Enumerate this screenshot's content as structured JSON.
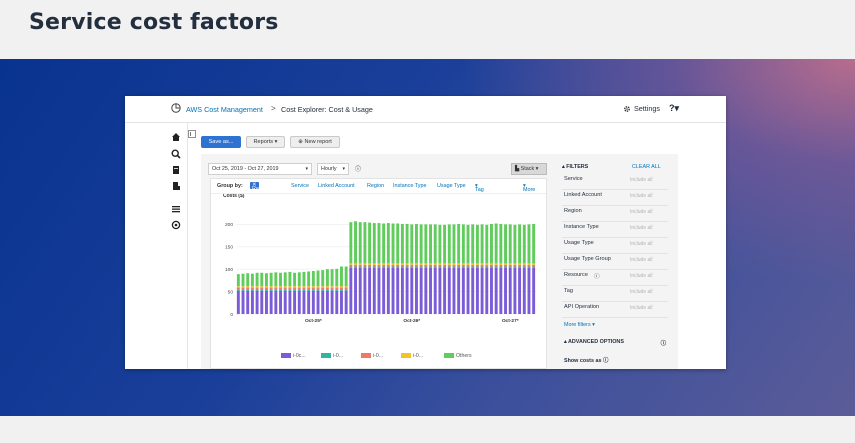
{
  "page": {
    "title": "Service cost factors"
  },
  "console": {
    "breadcrumb": {
      "root": "AWS Cost Management",
      "separator": ">",
      "current": "Cost Explorer: Cost & Usage"
    },
    "settings_label": "Settings",
    "help_label": "?",
    "toolbar": {
      "save": "Save as...",
      "reports": "Reports",
      "new_report": "New report"
    },
    "controls": {
      "date_range": "Oct 25, 2019 - Oct 27, 2019",
      "granularity": "Hourly",
      "chart_style": "Stack"
    },
    "group_by": {
      "label": "Group by:",
      "selected": "Resource",
      "options": [
        "Service",
        "Linked Account",
        "Region",
        "Instance Type",
        "Usage Type",
        "Tag"
      ],
      "more": "More"
    },
    "filters": {
      "title": "FILTERS",
      "clear_all": "CLEAR ALL",
      "rows": [
        {
          "label": "Service",
          "value": "Include all"
        },
        {
          "label": "Linked Account",
          "value": "Include all"
        },
        {
          "label": "Region",
          "value": "Include all"
        },
        {
          "label": "Instance Type",
          "value": "Include all"
        },
        {
          "label": "Usage Type",
          "value": "Include all"
        },
        {
          "label": "Usage Type Group",
          "value": "Include all"
        },
        {
          "label": "Resource",
          "value": "Include all"
        },
        {
          "label": "Tag",
          "value": "Include all"
        },
        {
          "label": "API Operation",
          "value": "Include all"
        }
      ],
      "more_filters": "More filters",
      "advanced_options": "ADVANCED OPTIONS",
      "show_costs_as": "Show costs as"
    }
  },
  "colors": {
    "purple": "#7b5cd6",
    "teal": "#2fb5a0",
    "salmon": "#f07866",
    "yellow": "#f5c323",
    "green": "#5fcc5c",
    "primary": "#2e72d2",
    "link": "#0073bb"
  },
  "chart_data": {
    "type": "bar",
    "stacked": true,
    "ylabel": "Costs ($)",
    "ylim": [
      0,
      250
    ],
    "yticks": [
      0,
      50,
      100,
      150,
      200
    ],
    "x_tick_labels": [
      "Oct-25*",
      "Oct-26*",
      "Oct-27*"
    ],
    "grid": true,
    "legend_position": "bottom",
    "series": [
      {
        "name": "i-0c...",
        "color": "#7b5cd6"
      },
      {
        "name": "i-0...",
        "color": "#2fb5a0"
      },
      {
        "name": "i-0...",
        "color": "#f07866"
      },
      {
        "name": "i-0...",
        "color": "#f5c323"
      },
      {
        "name": "Others",
        "color": "#5fcc5c"
      }
    ],
    "totals": [
      89,
      90,
      91,
      90,
      92,
      92,
      91,
      92,
      93,
      92,
      93,
      94,
      92,
      93,
      94,
      95,
      96,
      97,
      98,
      100,
      100,
      101,
      106,
      106,
      205,
      207,
      205,
      205,
      204,
      203,
      203,
      202,
      203,
      202,
      202,
      201,
      201,
      200,
      201,
      200,
      200,
      200,
      200,
      199,
      199,
      200,
      200,
      201,
      200,
      199,
      200,
      199,
      200,
      199,
      201,
      202,
      201,
      200,
      200,
      199,
      200,
      199,
      200,
      201
    ],
    "segments_by_phase": {
      "before_jump": {
        "purple": 52,
        "teal": 3,
        "salmon": 4,
        "yellow": 3
      },
      "after_jump": {
        "purple": 103,
        "teal": 3,
        "salmon": 4,
        "yellow": 3
      }
    }
  }
}
